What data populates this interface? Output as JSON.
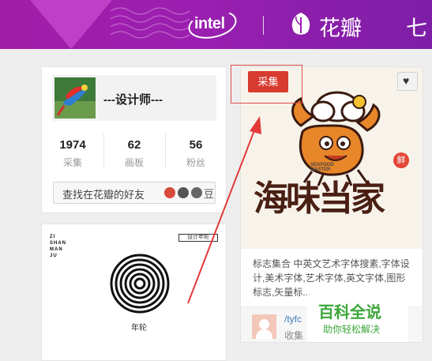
{
  "banner": {
    "intel_logo": "intel",
    "site_name": "花瓣",
    "right_char": "七",
    "colors": {
      "bg": "#9a1fb0",
      "accent": "#c84ccf"
    }
  },
  "profile": {
    "username": "---设计师---",
    "stats": [
      {
        "value": "1974",
        "label": "采集"
      },
      {
        "value": "62",
        "label": "画板"
      },
      {
        "value": "56",
        "label": "粉丝"
      }
    ],
    "find_friends": "找在花瓣的好友",
    "find_friends_prefix": "查",
    "social_icons": [
      "weibo-icon",
      "qq-icon",
      "renren-icon"
    ],
    "douban_label": "豆"
  },
  "left_card": {
    "poster_header": "ZI\nSHAN\nMAN\nJU",
    "poster_title": "年轮",
    "poster_tag": "设计年轮"
  },
  "pin": {
    "collect_button": "采集",
    "logo_badge": "鲜",
    "logo_text_en": "SEAFOOD\nMASTER",
    "logo_text_cn": "海味当家",
    "description": "标志集合 中英文艺术字体搜素,字体设计,美术字体,艺术字体,英文字体,图形标志,矢量标",
    "description_suffix": "...",
    "user_line": "/tyfc",
    "action_line": "收集",
    "accent_color": "#d83b2f"
  },
  "watermark": {
    "title": "百科全说",
    "subtitle": "助你轻松解决"
  }
}
